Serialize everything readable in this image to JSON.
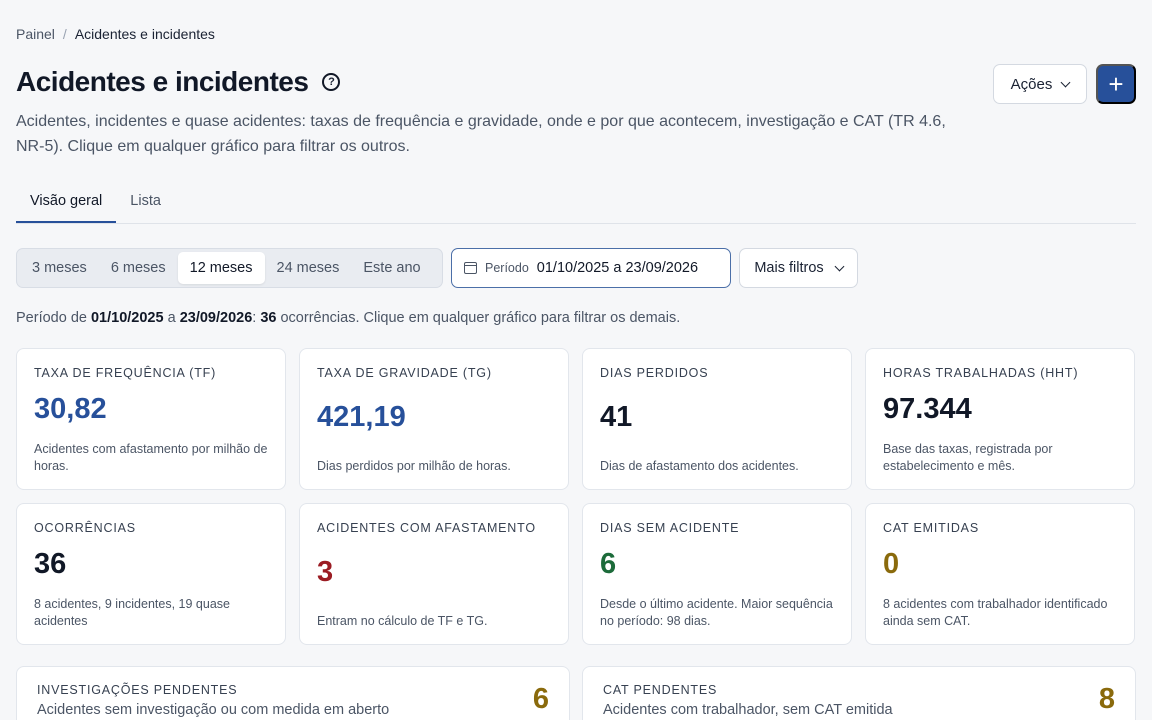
{
  "breadcrumb": {
    "root": "Painel",
    "separator": "/",
    "current": "Acidentes e incidentes"
  },
  "header": {
    "title": "Acidentes e incidentes",
    "help_glyph": "?",
    "actions_label": "Ações",
    "add_glyph": "+",
    "subtitle": "Acidentes, incidentes e quase acidentes: taxas de frequência e gravidade, onde e por que acontecem, investigação e CAT (TR 4.6, NR-5). Clique em qualquer gráfico para filtrar os outros."
  },
  "tabs": [
    {
      "label": "Visão geral",
      "active": true
    },
    {
      "label": "Lista",
      "active": false
    }
  ],
  "ranges": [
    {
      "label": "3 meses",
      "active": false
    },
    {
      "label": "6 meses",
      "active": false
    },
    {
      "label": "12 meses",
      "active": true
    },
    {
      "label": "24 meses",
      "active": false
    },
    {
      "label": "Este ano",
      "active": false
    }
  ],
  "period": {
    "label": "Período",
    "value": "01/10/2025 a 23/09/2026"
  },
  "filters": {
    "label": "Mais filtros"
  },
  "summary": {
    "prefix": "Período de ",
    "start": "01/10/2025",
    "mid": " a ",
    "end": "23/09/2026",
    "colon": ": ",
    "count": "36",
    "suffix": " ocorrências. Clique em qualquer gráfico para filtrar os demais."
  },
  "kpis": [
    {
      "label": "TAXA DE FREQUÊNCIA (TF)",
      "value": "30,82",
      "desc": "Acidentes com afastamento por milhão de horas.",
      "color": "#27509a"
    },
    {
      "label": "TAXA DE GRAVIDADE (TG)",
      "value": "421,19",
      "desc": "Dias perdidos por milhão de horas.",
      "color": "#27509a"
    },
    {
      "label": "DIAS PERDIDOS",
      "value": "41",
      "desc": "Dias de afastamento dos acidentes.",
      "color": "#111827"
    },
    {
      "label": "HORAS TRABALHADAS (HHT)",
      "value": "97.344",
      "desc": "Base das taxas, registrada por estabelecimento e mês.",
      "color": "#111827"
    },
    {
      "label": "OCORRÊNCIAS",
      "value": "36",
      "desc": "8 acidentes, 9 incidentes, 19 quase acidentes",
      "color": "#111827"
    },
    {
      "label": "ACIDENTES COM AFASTAMENTO",
      "value": "3",
      "desc": "Entram no cálculo de TF e TG.",
      "color": "#9b1c23"
    },
    {
      "label": "DIAS SEM ACIDENTE",
      "value": "6",
      "desc": "Desde o último acidente. Maior sequência no período: 98 dias.",
      "color": "#1c6b3a"
    },
    {
      "label": "CAT EMITIDAS",
      "value": "0",
      "desc": "8 acidentes com trabalhador identificado ainda sem CAT.",
      "color": "#8a6a0c"
    }
  ],
  "pending": [
    {
      "label": "INVESTIGAÇÕES PENDENTES",
      "desc": "Acidentes sem investigação ou com medida em aberto",
      "value": "6"
    },
    {
      "label": "CAT PENDENTES",
      "desc": "Acidentes com trabalhador, sem CAT emitida",
      "value": "8"
    }
  ],
  "icons": {
    "help": "help-circle-icon",
    "calendar": "calendar-icon",
    "chevron": "chevron-down-icon",
    "plus": "plus-icon"
  }
}
